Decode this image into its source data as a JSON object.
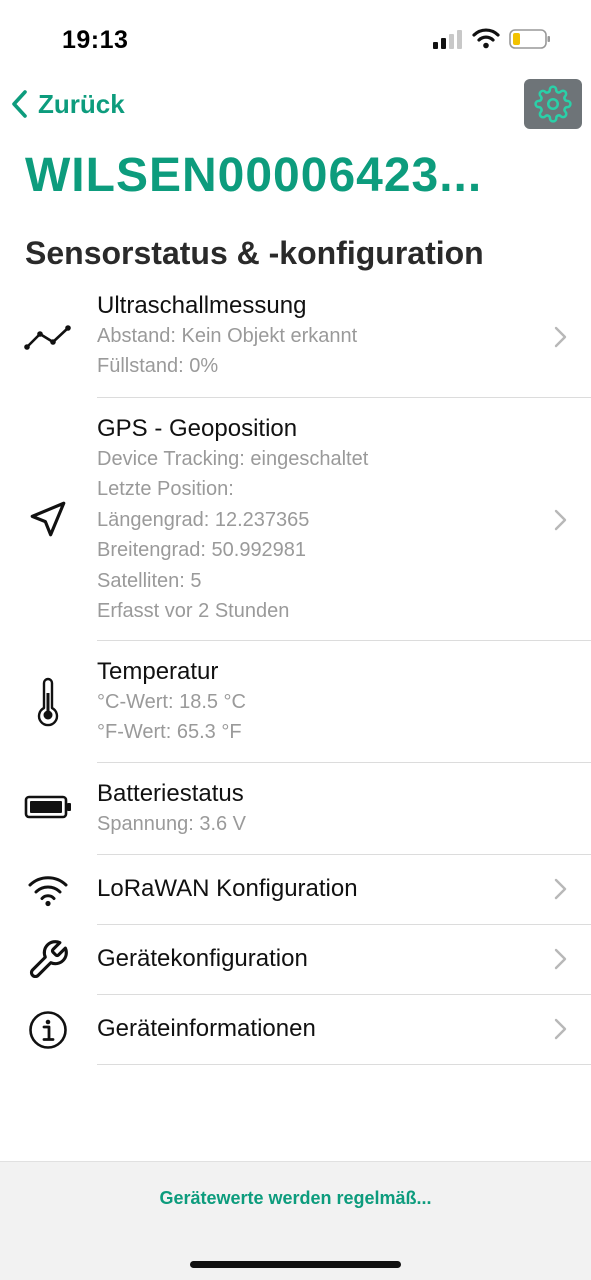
{
  "status_bar": {
    "time": "19:13"
  },
  "nav": {
    "back_label": "Zurück"
  },
  "device": {
    "title": "WILSEN00006423..."
  },
  "section": {
    "title": "Sensorstatus & -konfiguration"
  },
  "rows": [
    {
      "title": "Ultraschallmessung",
      "details": [
        "Abstand: Kein Objekt erkannt",
        "Füllstand: 0%"
      ],
      "icon": "line-chart-icon",
      "has_chevron": true
    },
    {
      "title": "GPS - Geoposition",
      "details": [
        "Device Tracking: eingeschaltet",
        "Letzte Position:",
        "Längengrad: 12.237365",
        "Breitengrad: 50.992981",
        "Satelliten: 5",
        "Erfasst vor 2 Stunden"
      ],
      "icon": "location-arrow-icon",
      "has_chevron": true
    },
    {
      "title": "Temperatur",
      "details": [
        "°C-Wert: 18.5 °C",
        "°F-Wert: 65.3 °F"
      ],
      "icon": "thermometer-icon",
      "has_chevron": false
    },
    {
      "title": "Batteriestatus",
      "details": [
        "Spannung: 3.6 V"
      ],
      "icon": "battery-icon",
      "has_chevron": false
    },
    {
      "title": "LoRaWAN Konfiguration",
      "details": [],
      "icon": "wifi-icon",
      "has_chevron": true
    },
    {
      "title": "Gerätekonfiguration",
      "details": [],
      "icon": "wrench-icon",
      "has_chevron": true
    },
    {
      "title": "Geräteinformationen",
      "details": [],
      "icon": "info-icon",
      "has_chevron": true
    }
  ],
  "footer": {
    "text": "Gerätewerte werden regelmäß..."
  },
  "colors": {
    "accent": "#0d9c7d",
    "settings_bg": "#6e7478",
    "detail_text": "#9a9a9a"
  }
}
